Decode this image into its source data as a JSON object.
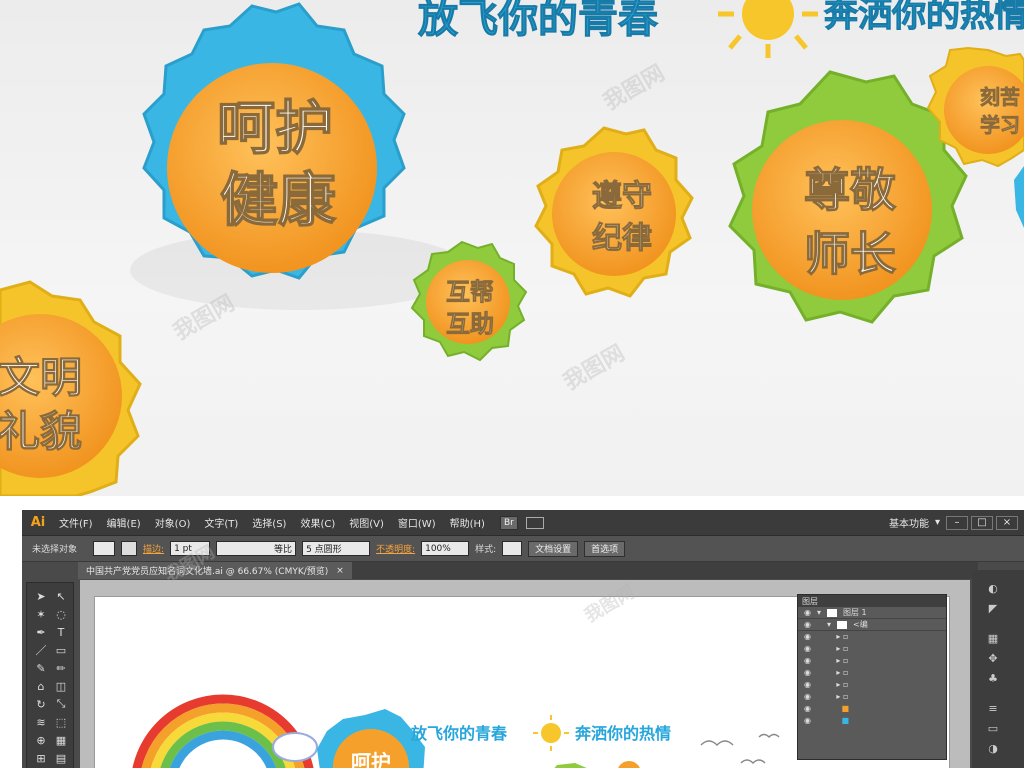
{
  "scene": {
    "headline_left": "放飞你的青春",
    "headline_right": "奔洒你的热情",
    "badges": [
      {
        "text_line1": "呵护",
        "text_line2": "健康",
        "color": "#39b6e3"
      },
      {
        "text_line1": "文明",
        "text_line2": "礼貌",
        "color": "#f5c42a"
      },
      {
        "text_line1": "互帮",
        "text_line2": "互助",
        "color": "#8fcb3c"
      },
      {
        "text_line1": "遵守",
        "text_line2": "纪律",
        "color": "#f5c42a"
      },
      {
        "text_line1": "尊敬",
        "text_line2": "师长",
        "color": "#8fcb3c"
      },
      {
        "text_line1": "刻苦",
        "text_line2": "学习",
        "color": "#f5c42a"
      }
    ],
    "watermark": "我图网"
  },
  "app": {
    "logo": "Ai",
    "menus": [
      "文件(F)",
      "编辑(E)",
      "对象(O)",
      "文字(T)",
      "选择(S)",
      "效果(C)",
      "视图(V)",
      "窗口(W)",
      "帮助(H)"
    ],
    "workspace": "基本功能",
    "bridge_label": "Br"
  },
  "control_bar": {
    "selection": "未选择对象",
    "stroke_label": "描边:",
    "stroke_value": "1 pt",
    "stroke_style": "等比",
    "brush": "5 点圆形",
    "opacity_label": "不透明度:",
    "opacity_value": "100%",
    "style_label": "样式:",
    "doc_setup": "文档设置",
    "preferences": "首选项"
  },
  "document_tab": {
    "title": "中国共产党党员应知名词文化墙.ai @ 66.67% (CMYK/预览)",
    "close": "×"
  },
  "artwork": {
    "headline_left": "放飞你的青春",
    "headline_right": "奔洒你的热情",
    "badge_text": "呵护"
  },
  "layers_panel": {
    "title": "图层",
    "layer_name": "图层 1",
    "sublayer": "<编"
  },
  "colors": {
    "accent": "#f6a21a",
    "ui_dark": "#4a4a4a"
  }
}
